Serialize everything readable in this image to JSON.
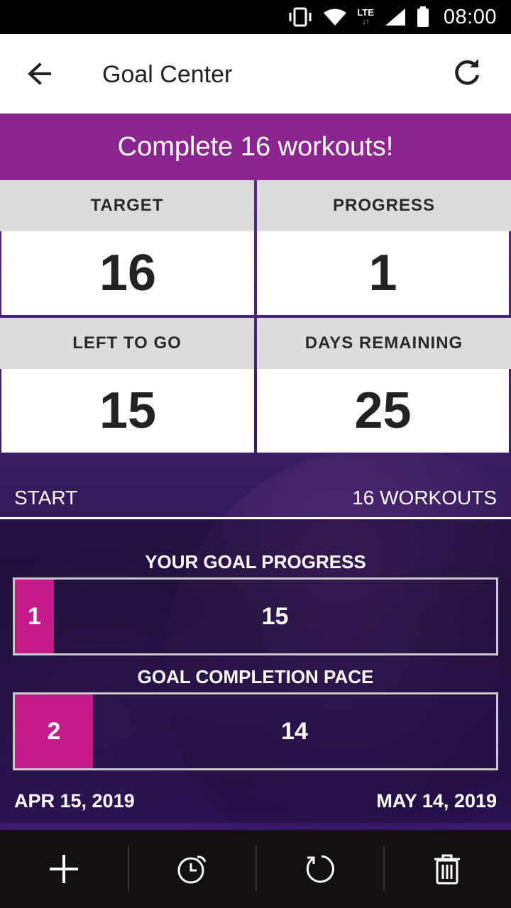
{
  "status_bar": {
    "network": "LTE",
    "time": "08:00",
    "icons": [
      "vibrate-icon",
      "wifi-icon",
      "lte-icon",
      "signal-icon",
      "battery-icon"
    ]
  },
  "app_bar": {
    "title": "Goal Center",
    "back_icon": "arrow-back-icon",
    "refresh_icon": "refresh-icon"
  },
  "goal": {
    "title": "Complete 16 workouts!",
    "stats": [
      {
        "label": "TARGET",
        "value": "16"
      },
      {
        "label": "PROGRESS",
        "value": "1"
      },
      {
        "label": "LEFT TO GO",
        "value": "15"
      },
      {
        "label": "DAYS REMAINING",
        "value": "25"
      }
    ]
  },
  "scale": {
    "start_label": "START",
    "end_label": "16 WORKOUTS"
  },
  "progress": {
    "title": "YOUR GOAL PROGRESS",
    "done": "1",
    "remaining": "15",
    "fraction": 0.0625
  },
  "pace": {
    "title": "GOAL COMPLETION PACE",
    "done": "2",
    "remaining": "14",
    "fraction": 0.125
  },
  "dates": {
    "start": "APR 15, 2019",
    "end": "MAY 14, 2019"
  },
  "toolbar": {
    "items": [
      "add-icon",
      "alarm-icon",
      "reset-icon",
      "trash-icon"
    ]
  },
  "colors": {
    "accent": "#c51b8a",
    "banner": "#8b2590",
    "toolbar": "#141010"
  }
}
